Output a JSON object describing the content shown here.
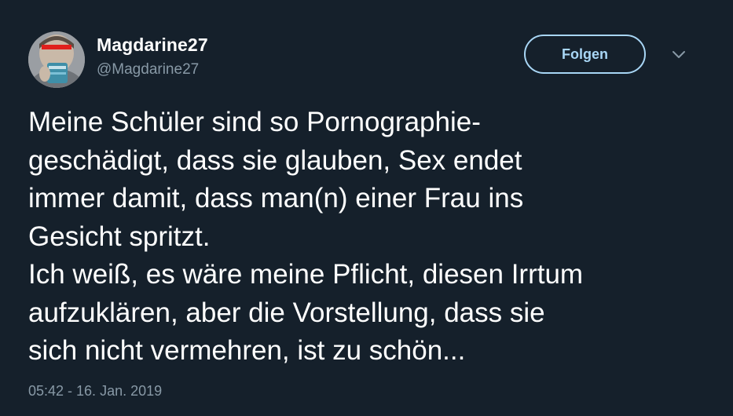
{
  "tweet": {
    "display_name": "Magdarine27",
    "handle": "@Magdarine27",
    "follow_label": "Folgen",
    "text_lines": [
      "Meine Schüler sind so Pornographie-",
      "geschädigt, dass sie glauben, Sex endet",
      "immer damit, dass man(n) einer Frau ins",
      "Gesicht spritzt.",
      "Ich weiß, es wäre meine Pflicht, diesen Irrtum",
      "aufzuklären, aber die Vorstellung, dass sie",
      "sich nicht vermehren, ist zu schön..."
    ],
    "timestamp": "05:42 - 16. Jan. 2019"
  },
  "icons": {
    "menu": "chevron-down-icon"
  },
  "colors": {
    "background": "#15202b",
    "text": "#ffffff",
    "secondary_text": "#8899a6",
    "accent": "#a8d6f5"
  }
}
